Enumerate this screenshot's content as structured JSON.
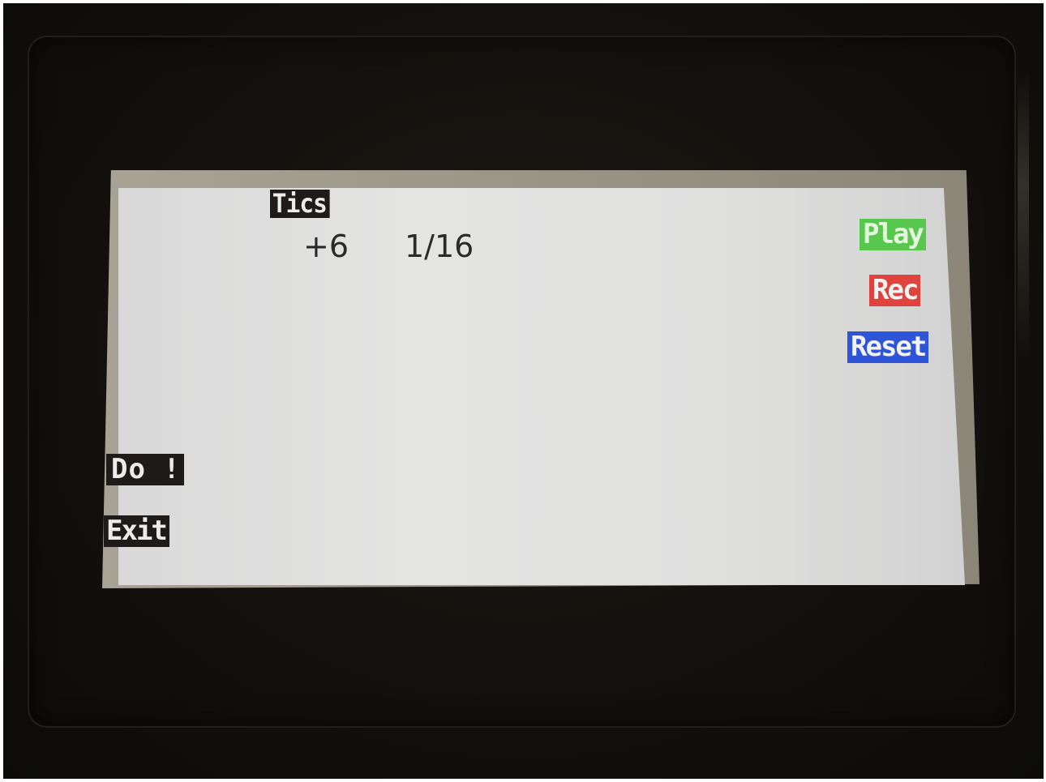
{
  "screen": {
    "title": "Tics",
    "tics_value": "+6",
    "note_value": "1/16"
  },
  "transport": {
    "play_label": "Play",
    "rec_label": "Rec",
    "reset_label": "Reset",
    "colors": {
      "play": "#58c74e",
      "rec": "#e0433d",
      "reset": "#2e55d9"
    }
  },
  "actions": {
    "do_label": "Do !",
    "exit_label": "Exit"
  }
}
